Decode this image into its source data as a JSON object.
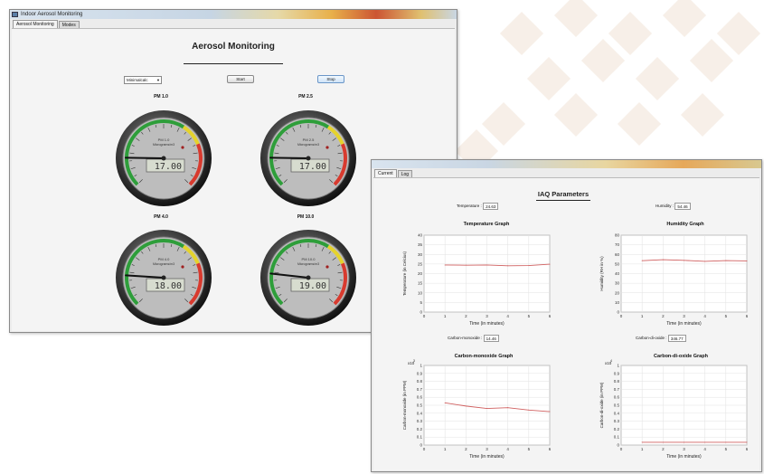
{
  "aerosol_window": {
    "title": "Indoor Aerosol Monitoring",
    "tabs": [
      "Aerosol Monitoring",
      "Modes"
    ],
    "heading": "Aerosol Monitoring",
    "mode_select": "Minimalcalc",
    "start_label": "Start",
    "stop_label": "Stop",
    "gauges": [
      {
        "label": "PM 1.0",
        "reading": "17.00",
        "inner_title": "PM 1.0",
        "unit": "Micrograms/m3"
      },
      {
        "label": "PM 2.5",
        "reading": "17.00",
        "inner_title": "PM 2.5",
        "unit": "Micrograms/m3"
      },
      {
        "label": "PM 4.0",
        "reading": "18.00",
        "inner_title": "PM 4.0",
        "unit": "Micrograms/m3"
      },
      {
        "label": "PM 10.0",
        "reading": "19.00",
        "inner_title": "PM 10.0",
        "unit": "Micrograms/m3"
      }
    ],
    "gauge_scale_max": 100,
    "colors": {
      "green": "#2e9e3a",
      "yellow": "#e5d32c",
      "red": "#d83a2e"
    }
  },
  "iaq_window": {
    "tabs": [
      "Current",
      "Log"
    ],
    "heading": "IAQ Parameters",
    "temperature_label": "Temperature",
    "temperature_value": "24.63",
    "humidity_label": "Humidity",
    "humidity_value": "54.46",
    "co_label": "Carbon-monoxide",
    "co_value": "14.46",
    "co2_label": "Carbon-di-oxide",
    "co2_value": "346.77"
  },
  "chart_data": [
    {
      "type": "line",
      "title": "Temperature Graph",
      "xlabel": "Time (in minutes)",
      "ylabel": "Temperature (in Celcius)",
      "xlim": [
        0,
        6
      ],
      "ylim": [
        0,
        40
      ],
      "xticks": [
        "0",
        "1",
        "2",
        "3",
        "4",
        "5",
        "6"
      ],
      "yticks": [
        "0",
        "5",
        "10",
        "15",
        "20",
        "25",
        "30",
        "35",
        "40"
      ],
      "x": [
        1,
        2,
        3,
        4,
        5,
        6
      ],
      "values": [
        24.5,
        24.4,
        24.5,
        24.1,
        24.2,
        24.9
      ],
      "line_color": "#d06060"
    },
    {
      "type": "line",
      "title": "Humidity Graph",
      "xlabel": "Time (in minutes)",
      "ylabel": "Humidity (RH in %)",
      "xlim": [
        0,
        6
      ],
      "ylim": [
        0,
        80
      ],
      "xticks": [
        "0",
        "1",
        "2",
        "3",
        "4",
        "5",
        "6"
      ],
      "yticks": [
        "0",
        "10",
        "20",
        "30",
        "40",
        "50",
        "60",
        "70",
        "80"
      ],
      "x": [
        1,
        2,
        3,
        4,
        5,
        6
      ],
      "values": [
        53.5,
        54.5,
        53.8,
        52.8,
        53.6,
        53.2
      ],
      "line_color": "#d06060"
    },
    {
      "type": "line",
      "title": "Carbon-monoxide Graph",
      "xlabel": "Time (in minutes)",
      "ylabel": "Carbon-monoxide (in PPM)",
      "multiplier": "x10",
      "multiplier_exp": "3",
      "xlim": [
        0,
        6
      ],
      "ylim": [
        0,
        1
      ],
      "xticks": [
        "0",
        "1",
        "2",
        "3",
        "4",
        "5",
        "6"
      ],
      "yticks": [
        "0",
        "0.1",
        "0.2",
        "0.3",
        "0.4",
        "0.5",
        "0.6",
        "0.7",
        "0.8",
        "0.9",
        "1"
      ],
      "x": [
        1,
        2,
        3,
        4,
        5,
        6
      ],
      "values": [
        0.53,
        0.49,
        0.46,
        0.47,
        0.44,
        0.42
      ],
      "line_color": "#d06060"
    },
    {
      "type": "line",
      "title": "Carbon-di-oxide Graph",
      "xlabel": "Time (in minutes)",
      "ylabel": "Carbon-di-oxide (in PPM)",
      "multiplier": "x10",
      "multiplier_exp": "4",
      "xlim": [
        0,
        6
      ],
      "ylim": [
        0,
        1
      ],
      "xticks": [
        "0",
        "1",
        "2",
        "3",
        "4",
        "5",
        "6"
      ],
      "yticks": [
        "0",
        "0.1",
        "0.2",
        "0.3",
        "0.4",
        "0.5",
        "0.6",
        "0.7",
        "0.8",
        "0.9",
        "1"
      ],
      "x": [
        1,
        2,
        3,
        4,
        5,
        6
      ],
      "values": [
        0.035,
        0.035,
        0.035,
        0.035,
        0.035,
        0.035
      ],
      "line_color": "#d06060"
    }
  ]
}
